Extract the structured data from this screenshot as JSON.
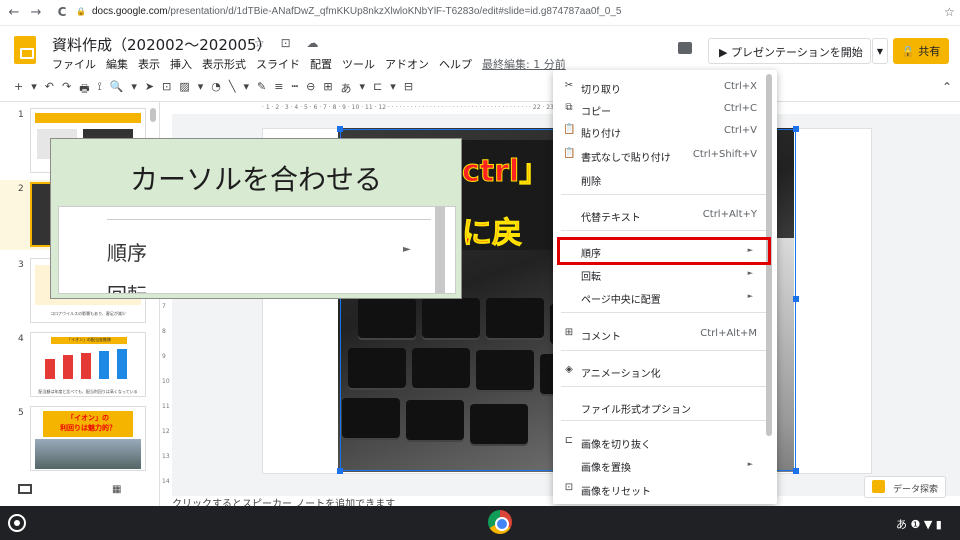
{
  "browser": {
    "url_host": "docs.google.com",
    "url_path": "/presentation/d/1dTBie-ANafDwZ_qfmKKUp8nkzXlwloKNbYlF-T6283o/edit#slide=id.g874787aa0f_0_5",
    "back_icon": "←",
    "forward_icon": "→",
    "reload_icon": "C",
    "lock_icon": "🔒",
    "star_icon": "☆"
  },
  "doc": {
    "title": "資料作成（202002〜202005）",
    "title_icons": "☆ ⊡ ☁",
    "menus": [
      "ファイル",
      "編集",
      "表示",
      "挿入",
      "表示形式",
      "スライド",
      "配置",
      "ツール",
      "アドオン",
      "ヘルプ"
    ],
    "last_edit": "最終編集: 1 分前",
    "present_label": "▶  プレゼンテーションを開始",
    "present_dropdown": "▼",
    "share_label": "🔒 共有"
  },
  "toolbar": {
    "items": [
      "+",
      "▾",
      "↶",
      "↷",
      "🖶",
      "⟟",
      "🔍",
      "▾",
      "➤",
      "⊡",
      "▨",
      "▾",
      "◔",
      "╲",
      "▾",
      "✎",
      "≡",
      "┅",
      "⊖",
      "⊞",
      "あ",
      "▾",
      "⊏",
      "▾",
      "⊟"
    ],
    "collapse_icon": "⌃"
  },
  "ruler": {
    "text": "· 1 · 2 · 3 · 4 · 5 · 6 · 7 · 8 · 9 · 10 · 11 · 12 · · · · · · · · · · · · · · · · · · · · · · · · · · · · · · · · · · · · · · 22 · 23 · 24 · 25 ·"
  },
  "filmstrip": {
    "slides": [
      {
        "num": "1"
      },
      {
        "num": "2"
      },
      {
        "num": "3",
        "caption": "コロナウイルスの影響もあり、客足が減少"
      },
      {
        "num": "4",
        "title": "「イオン」の配当金推移",
        "caption": "配当額は年度と比べても、配当利回りは高くなっている"
      },
      {
        "num": "5",
        "title": "「イオン」の\n利回りは魅力的？"
      }
    ]
  },
  "slide": {
    "banner_line1": "ctrl」",
    "banner_line2": "に戻"
  },
  "speaker_notes": "クリックするとスピーカー ノートを追加できます",
  "callout": {
    "title": "カーソルを合わせる",
    "item1": "順序",
    "item1_arrow": "►",
    "item2": "回転"
  },
  "context_menu": {
    "items": [
      {
        "icon": "✂",
        "label": "切り取り",
        "shortcut": "Ctrl+X"
      },
      {
        "icon": "⧉",
        "label": "コピー",
        "shortcut": "Ctrl+C"
      },
      {
        "icon": "📋",
        "label": "貼り付け",
        "shortcut": "Ctrl+V"
      },
      {
        "icon": "📋",
        "label": "書式なしで貼り付け",
        "shortcut": "Ctrl+Shift+V"
      },
      {
        "icon": "",
        "label": "削除",
        "shortcut": ""
      },
      {
        "icon": "",
        "label": "代替テキスト",
        "shortcut": "Ctrl+Alt+Y"
      },
      {
        "icon": "",
        "label": "順序",
        "submenu": "►"
      },
      {
        "icon": "",
        "label": "回転",
        "submenu": "►"
      },
      {
        "icon": "",
        "label": "ページ中央に配置",
        "submenu": "►"
      },
      {
        "icon": "⊞",
        "label": "コメント",
        "shortcut": "Ctrl+Alt+M"
      },
      {
        "icon": "◈",
        "label": "アニメーション化",
        "shortcut": ""
      },
      {
        "icon": "",
        "label": "ファイル形式オプション",
        "shortcut": ""
      },
      {
        "icon": "⊏",
        "label": "画像を切り抜く",
        "shortcut": ""
      },
      {
        "icon": "",
        "label": "画像を置換",
        "submenu": "►"
      },
      {
        "icon": "⊡",
        "label": "画像をリセット",
        "shortcut": ""
      }
    ]
  },
  "explore": {
    "label": "データ探索"
  },
  "shelf": {
    "tray": "あ ❶ ▼ ▮"
  }
}
